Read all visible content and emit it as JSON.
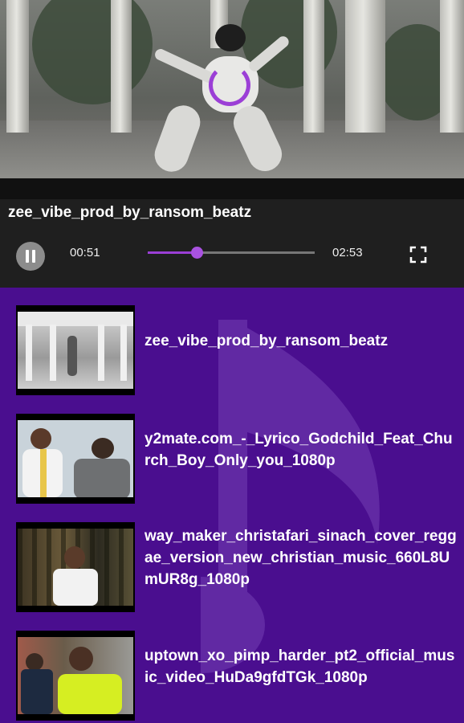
{
  "player": {
    "title": "zee_vibe_prod_by_ransom_beatz",
    "elapsed": "00:51",
    "duration": "02:53",
    "progress": 0.295,
    "state": "playing",
    "accent": "#9b3fd6"
  },
  "icons": {
    "pause": "pause-icon",
    "fullscreen": "fullscreen-icon",
    "loading": "loading-spinner-icon",
    "background": "music-note-icon"
  },
  "playlist": {
    "background": "#4a0e8f",
    "items": [
      {
        "title": "zee_vibe_prod_by_ransom_beatz"
      },
      {
        "title": "y2mate.com_-_Lyrico_Godchild_Feat_Church_Boy_Only_you_1080p"
      },
      {
        "title": "way_maker_christafari_sinach_cover_reggae_version_new_christian_music_660L8UmUR8g_1080p"
      },
      {
        "title": "uptown_xo_pimp_harder_pt2_official_music_video_HuDa9gfdTGk_1080p"
      }
    ]
  }
}
